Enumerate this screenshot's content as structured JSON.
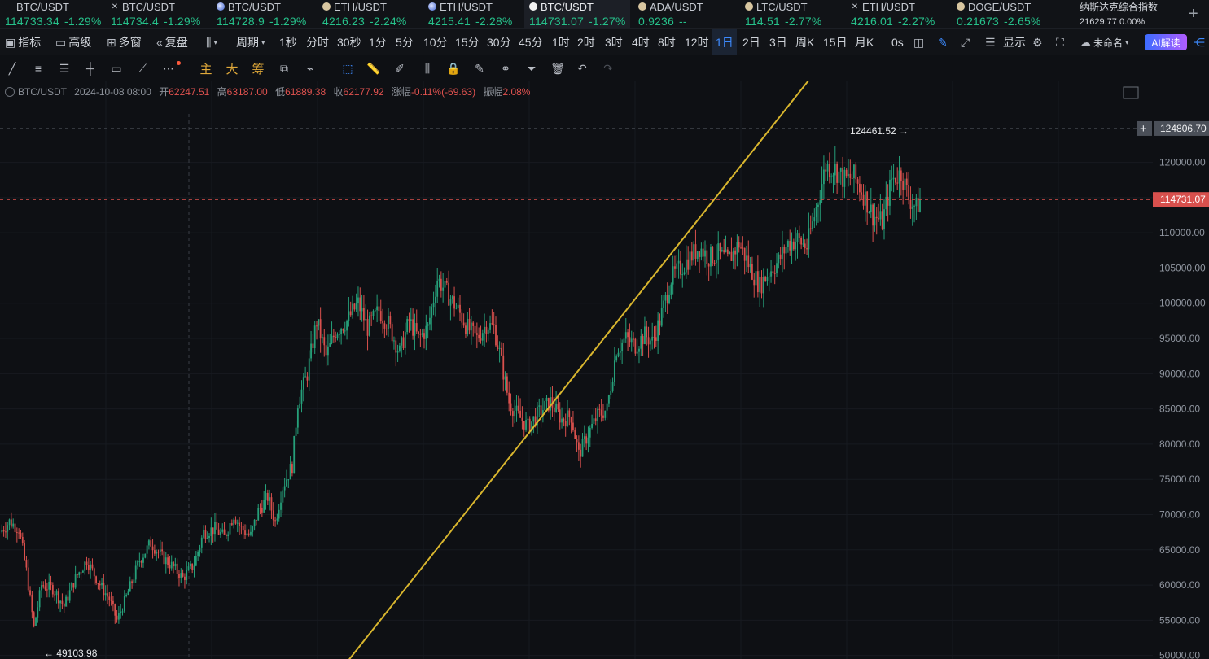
{
  "tickers": [
    {
      "symbol": "BTC/USDT",
      "price": "114733.34",
      "change": "-1.29%",
      "icon": "none",
      "color": "#26c08a"
    },
    {
      "symbol": "BTC/USDT",
      "price": "114734.4",
      "change": "-1.29%",
      "icon": "x-icon",
      "color": "#26c08a"
    },
    {
      "symbol": "BTC/USDT",
      "price": "114728.9",
      "change": "-1.29%",
      "icon": "globe-icon",
      "color": "#26c08a"
    },
    {
      "symbol": "ETH/USDT",
      "price": "4216.23",
      "change": "-2.24%",
      "icon": "coin-icon",
      "color": "#26c08a"
    },
    {
      "symbol": "ETH/USDT",
      "price": "4215.41",
      "change": "-2.28%",
      "icon": "globe-icon",
      "color": "#26c08a"
    },
    {
      "symbol": "BTC/USDT",
      "price": "114731.07",
      "change": "-1.27%",
      "icon": "drop-icon",
      "color": "#26c08a",
      "active": true
    },
    {
      "symbol": "ADA/USDT",
      "price": "0.9236",
      "change": "--",
      "icon": "coin-icon",
      "color": "#26c08a"
    },
    {
      "symbol": "LTC/USDT",
      "price": "114.51",
      "change": "-2.77%",
      "icon": "coin-icon",
      "color": "#26c08a"
    },
    {
      "symbol": "ETH/USDT",
      "price": "4216.01",
      "change": "-2.27%",
      "icon": "x-icon",
      "color": "#26c08a"
    },
    {
      "symbol": "DOGE/USDT",
      "price": "0.21673",
      "change": "-2.65%",
      "icon": "coin-icon",
      "color": "#26c08a"
    }
  ],
  "nasdaq": {
    "name": "纳斯达克综合指数",
    "value": "21629.77",
    "change": "0.00%"
  },
  "toolbar": {
    "indicators": "指标",
    "advanced": "高级",
    "multi_window": "多窗",
    "replay": "复盘",
    "period": "周期",
    "intervals": [
      "1秒",
      "分时",
      "30秒",
      "1分",
      "5分",
      "10分",
      "15分",
      "30分",
      "45分",
      "1时",
      "2时",
      "3时",
      "4时",
      "8时",
      "12时",
      "1日",
      "2日",
      "3日",
      "周K",
      "15日",
      "月K"
    ],
    "active_interval": "1日",
    "countdown": "0s",
    "display": "显示",
    "workspace": "未命名",
    "ai_label": "AI解读"
  },
  "drawing_tools": {
    "main": "主",
    "large": "大",
    "chips": "筹"
  },
  "ohlc": {
    "symbol": "BTC/USDT",
    "datetime": "2024-10-08 08:00",
    "open_label": "开",
    "open": "62247.51",
    "high_label": "高",
    "high": "63187.00",
    "low_label": "低",
    "low": "61889.38",
    "close_label": "收",
    "close": "62177.92",
    "change_label": "涨幅",
    "change": "-0.11%(-69.63)",
    "amp_label": "振幅",
    "amplitude": "2.08%"
  },
  "chart_data": {
    "type": "candlestick",
    "symbol": "BTC/USDT",
    "interval": "1日",
    "y_ticks": [
      50000,
      55000,
      60000,
      65000,
      70000,
      75000,
      80000,
      85000,
      90000,
      95000,
      100000,
      105000,
      110000,
      115000,
      120000
    ],
    "y_tick_labels": [
      "50000.00",
      "55000.00",
      "60000.00",
      "65000.00",
      "70000.00",
      "75000.00",
      "80000.00",
      "85000.00",
      "90000.00",
      "95000.00",
      "100000.00",
      "105000.00",
      "110000.00",
      "120000.00"
    ],
    "ylim": [
      49500,
      131500
    ],
    "high_marker": "124461.52",
    "low_marker": "49103.98",
    "crosshair_price": "124806.70",
    "last_price": "114731.07",
    "close_path": [
      [
        0,
        67500
      ],
      [
        5,
        69000
      ],
      [
        10,
        68000
      ],
      [
        14,
        62000
      ],
      [
        18,
        54000
      ],
      [
        22,
        60000
      ],
      [
        28,
        59500
      ],
      [
        34,
        57000
      ],
      [
        40,
        61000
      ],
      [
        46,
        63500
      ],
      [
        52,
        60500
      ],
      [
        58,
        58000
      ],
      [
        62,
        55000
      ],
      [
        68,
        59000
      ],
      [
        74,
        63500
      ],
      [
        80,
        66000
      ],
      [
        86,
        64000
      ],
      [
        92,
        62500
      ],
      [
        97,
        61000
      ],
      [
        103,
        63000
      ],
      [
        108,
        67500
      ],
      [
        114,
        68000
      ],
      [
        119,
        66800
      ],
      [
        124,
        70000
      ],
      [
        128,
        68000
      ],
      [
        133,
        67000
      ],
      [
        137,
        70500
      ],
      [
        142,
        72500
      ],
      [
        146,
        69000
      ],
      [
        150,
        74000
      ],
      [
        155,
        77000
      ],
      [
        158,
        86000
      ],
      [
        163,
        90000
      ],
      [
        168,
        97500
      ],
      [
        173,
        92500
      ],
      [
        178,
        96000
      ],
      [
        184,
        97500
      ],
      [
        190,
        100000
      ],
      [
        195,
        96500
      ],
      [
        201,
        99000
      ],
      [
        206,
        97000
      ],
      [
        212,
        93000
      ],
      [
        217,
        97500
      ],
      [
        222,
        95000
      ],
      [
        227,
        96500
      ],
      [
        232,
        103500
      ],
      [
        237,
        101500
      ],
      [
        243,
        99000
      ],
      [
        248,
        96500
      ],
      [
        253,
        95000
      ],
      [
        258,
        97000
      ],
      [
        262,
        96500
      ],
      [
        265,
        93000
      ],
      [
        270,
        86000
      ],
      [
        275,
        84000
      ],
      [
        280,
        82500
      ],
      [
        286,
        84500
      ],
      [
        292,
        86000
      ],
      [
        298,
        83500
      ],
      [
        303,
        84000
      ],
      [
        307,
        78500
      ],
      [
        312,
        81500
      ],
      [
        317,
        84000
      ],
      [
        322,
        85000
      ],
      [
        327,
        93500
      ],
      [
        332,
        95000
      ],
      [
        337,
        94000
      ],
      [
        342,
        95500
      ],
      [
        346,
        94500
      ],
      [
        350,
        97500
      ],
      [
        356,
        103500
      ],
      [
        361,
        105000
      ],
      [
        366,
        106500
      ],
      [
        371,
        108000
      ],
      [
        376,
        106500
      ],
      [
        381,
        107000
      ],
      [
        386,
        106000
      ],
      [
        392,
        108500
      ],
      [
        398,
        105000
      ],
      [
        403,
        102500
      ],
      [
        408,
        104500
      ],
      [
        413,
        106000
      ],
      [
        418,
        108500
      ],
      [
        423,
        109000
      ],
      [
        428,
        108000
      ],
      [
        433,
        113500
      ],
      [
        438,
        119500
      ],
      [
        443,
        119000
      ],
      [
        448,
        117500
      ],
      [
        453,
        118000
      ],
      [
        458,
        115500
      ],
      [
        463,
        112500
      ],
      [
        468,
        111500
      ],
      [
        473,
        117500
      ],
      [
        478,
        118500
      ],
      [
        482,
        115000
      ],
      [
        486,
        113500
      ],
      [
        488,
        114731
      ]
    ],
    "x_range": [
      0,
      560
    ],
    "trendline": [
      [
        175,
        46000
      ],
      [
        430,
        132000
      ]
    ]
  }
}
